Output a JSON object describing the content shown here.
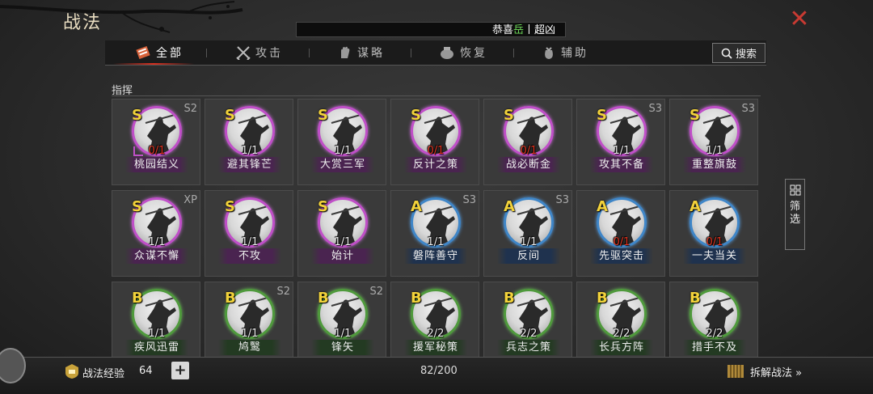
{
  "header": {
    "title": "战法",
    "close_symbol": "✕"
  },
  "ticker": {
    "prefix": "恭喜",
    "highlight": "岳",
    "suffix": "丨超凶"
  },
  "tabs": [
    {
      "label": "全部",
      "icon": "all-scroll-icon",
      "active": true
    },
    {
      "label": "攻击",
      "icon": "crossed-swords-icon",
      "active": false
    },
    {
      "label": "谋略",
      "icon": "strategy-hand-icon",
      "active": false
    },
    {
      "label": "恢复",
      "icon": "recovery-pot-icon",
      "active": false
    },
    {
      "label": "辅助",
      "icon": "support-bag-icon",
      "active": false
    }
  ],
  "search_label": "搜索",
  "section_label": "指挥",
  "side_filter": {
    "line1": "筛",
    "line2": "选"
  },
  "cards": [
    {
      "grade": "S",
      "tier": "S2",
      "count": "0/1",
      "zero": true,
      "name": "桃园结义",
      "selected": true
    },
    {
      "grade": "S",
      "tier": "",
      "count": "1/1",
      "zero": false,
      "name": "避其锋芒"
    },
    {
      "grade": "S",
      "tier": "",
      "count": "1/1",
      "zero": false,
      "name": "大赏三军"
    },
    {
      "grade": "S",
      "tier": "",
      "count": "0/1",
      "zero": true,
      "name": "反计之策"
    },
    {
      "grade": "S",
      "tier": "",
      "count": "0/1",
      "zero": true,
      "name": "战必断金"
    },
    {
      "grade": "S",
      "tier": "S3",
      "count": "1/1",
      "zero": false,
      "name": "攻其不备"
    },
    {
      "grade": "S",
      "tier": "S3",
      "count": "1/1",
      "zero": false,
      "name": "重整旗鼓"
    },
    {
      "grade": "S",
      "tier": "XP",
      "count": "1/1",
      "zero": false,
      "name": "众谋不懈"
    },
    {
      "grade": "S",
      "tier": "",
      "count": "1/1",
      "zero": false,
      "name": "不攻"
    },
    {
      "grade": "S",
      "tier": "",
      "count": "1/1",
      "zero": false,
      "name": "始计"
    },
    {
      "grade": "A",
      "tier": "S3",
      "count": "1/1",
      "zero": false,
      "name": "磐阵善守"
    },
    {
      "grade": "A",
      "tier": "S3",
      "count": "1/1",
      "zero": false,
      "name": "反间"
    },
    {
      "grade": "A",
      "tier": "",
      "count": "0/1",
      "zero": true,
      "name": "先驱突击"
    },
    {
      "grade": "A",
      "tier": "",
      "count": "0/1",
      "zero": true,
      "name": "一夫当关"
    },
    {
      "grade": "B",
      "tier": "",
      "count": "1/1",
      "zero": false,
      "name": "疾风迅雷"
    },
    {
      "grade": "B",
      "tier": "S2",
      "count": "1/1",
      "zero": false,
      "name": "鸠鹥"
    },
    {
      "grade": "B",
      "tier": "S2",
      "count": "1/1",
      "zero": false,
      "name": "锋矢"
    },
    {
      "grade": "B",
      "tier": "",
      "count": "2/2",
      "zero": false,
      "name": "援军秘策"
    },
    {
      "grade": "B",
      "tier": "",
      "count": "2/2",
      "zero": false,
      "name": "兵志之策"
    },
    {
      "grade": "B",
      "tier": "",
      "count": "2/2",
      "zero": false,
      "name": "长兵方阵"
    },
    {
      "grade": "B",
      "tier": "",
      "count": "2/2",
      "zero": false,
      "name": "措手不及"
    }
  ],
  "bottom": {
    "exp_label": "战法经验",
    "exp_value": "64",
    "plus": "+",
    "capacity": "82/200",
    "disassemble_label": "拆解战法 »"
  },
  "colors": {
    "grade_S": "#c04fc8",
    "grade_A": "#3f86c8",
    "grade_B": "#4f9a3c",
    "zero_count": "#e0321e",
    "close": "#c83a32",
    "ticker_highlight": "#6fdc5a"
  }
}
